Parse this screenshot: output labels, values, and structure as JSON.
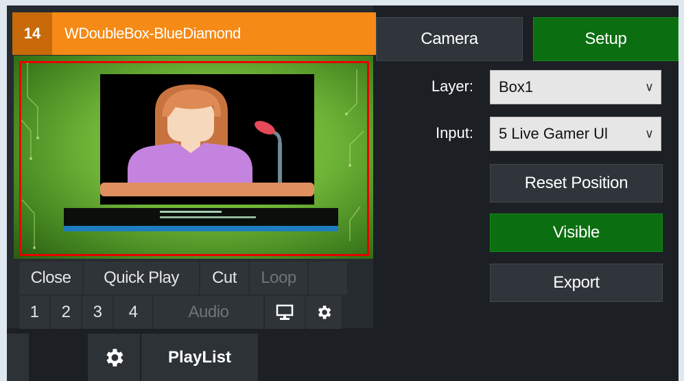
{
  "input": {
    "number": "14",
    "title": "WDoubleBox-BlueDiamond",
    "controls_row1": [
      "Close",
      "Quick Play",
      "Cut",
      "Loop"
    ],
    "controls_row2": [
      "1",
      "2",
      "3",
      "4",
      "Audio"
    ]
  },
  "tabs": {
    "camera": "Camera",
    "setup": "Setup"
  },
  "fields": {
    "layer_label": "Layer:",
    "layer_value": "Box1",
    "input_label": "Input:",
    "input_value": "5 Live Gamer Ul"
  },
  "buttons": {
    "reset_position": "Reset Position",
    "visible": "Visible",
    "export": "Export"
  },
  "bottom": {
    "playlist": "PlayList"
  },
  "icons": {
    "monitor": "monitor-icon",
    "settings": "gear-icon",
    "chevron": "chevron-down-icon"
  },
  "colors": {
    "title_orange": "#f58a16",
    "active_green": "#0b6e10",
    "selection_red": "#e80000"
  }
}
